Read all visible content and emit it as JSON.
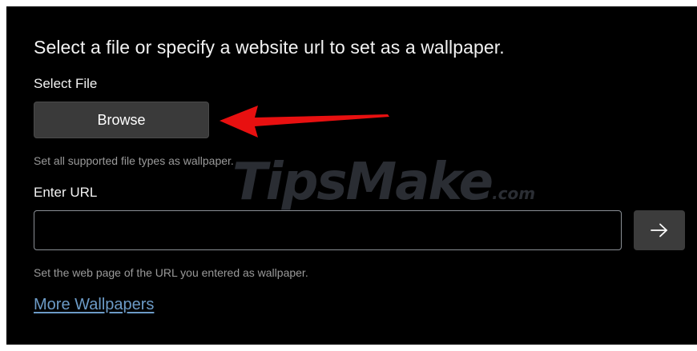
{
  "dialog": {
    "heading": "Select a file or specify a website url to set as a wallpaper.",
    "select_file_label": "Select File",
    "browse_button": "Browse",
    "file_hint": "Set all supported file types as wallpaper.",
    "enter_url_label": "Enter URL",
    "url_input": {
      "value": "",
      "placeholder": ""
    },
    "submit_icon": "arrow-right-icon",
    "url_hint": "Set the web page of the URL you entered as wallpaper.",
    "more_link": "More Wallpapers"
  },
  "annotation": {
    "arrow_icon": "red-pointer-arrow",
    "arrow_color": "#e81010"
  },
  "watermark": {
    "brand": "TipsMake",
    "suffix": ".com"
  },
  "colors": {
    "background": "#000000",
    "button": "#3a3a3a",
    "link": "#6c9bc7",
    "hint_text": "#9a9a9a"
  }
}
